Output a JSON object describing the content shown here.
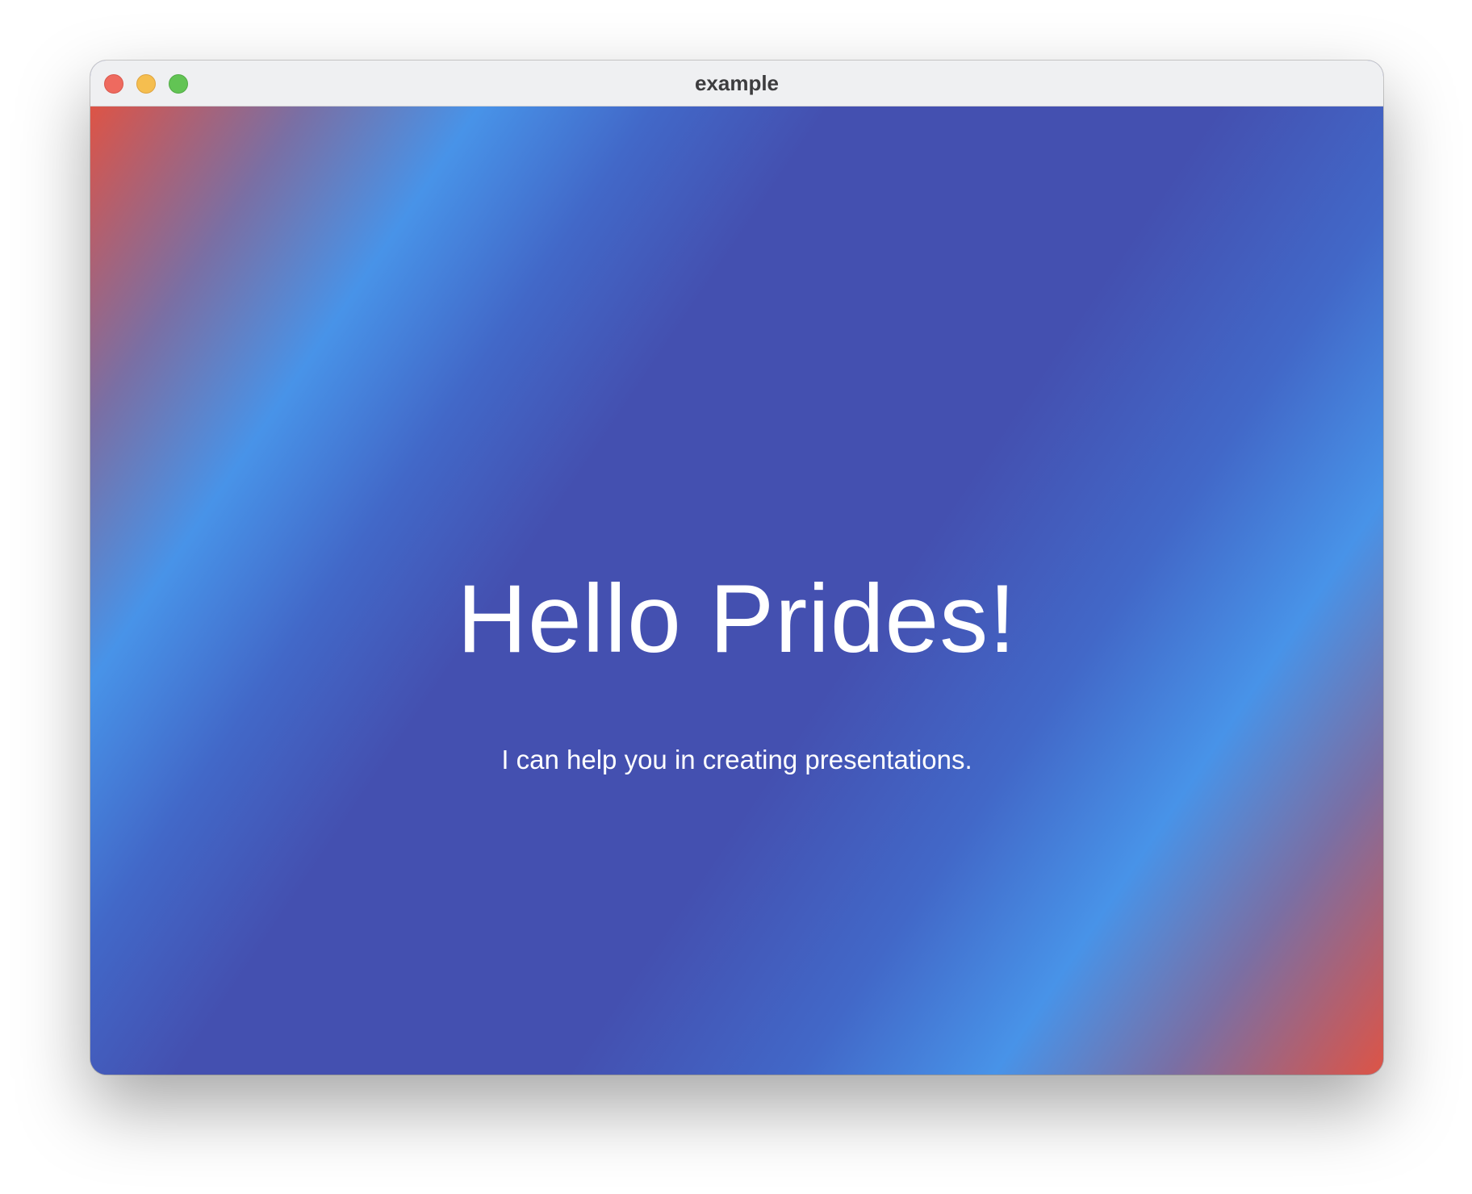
{
  "window": {
    "title": "example"
  },
  "main": {
    "headline": "Hello Prides!",
    "subtitle": "I can help you in creating presentations."
  },
  "colors": {
    "gradient_red": "#dd5446",
    "gradient_light_blue": "#4893e8",
    "gradient_indigo": "#4450b0",
    "text": "#ffffff"
  }
}
